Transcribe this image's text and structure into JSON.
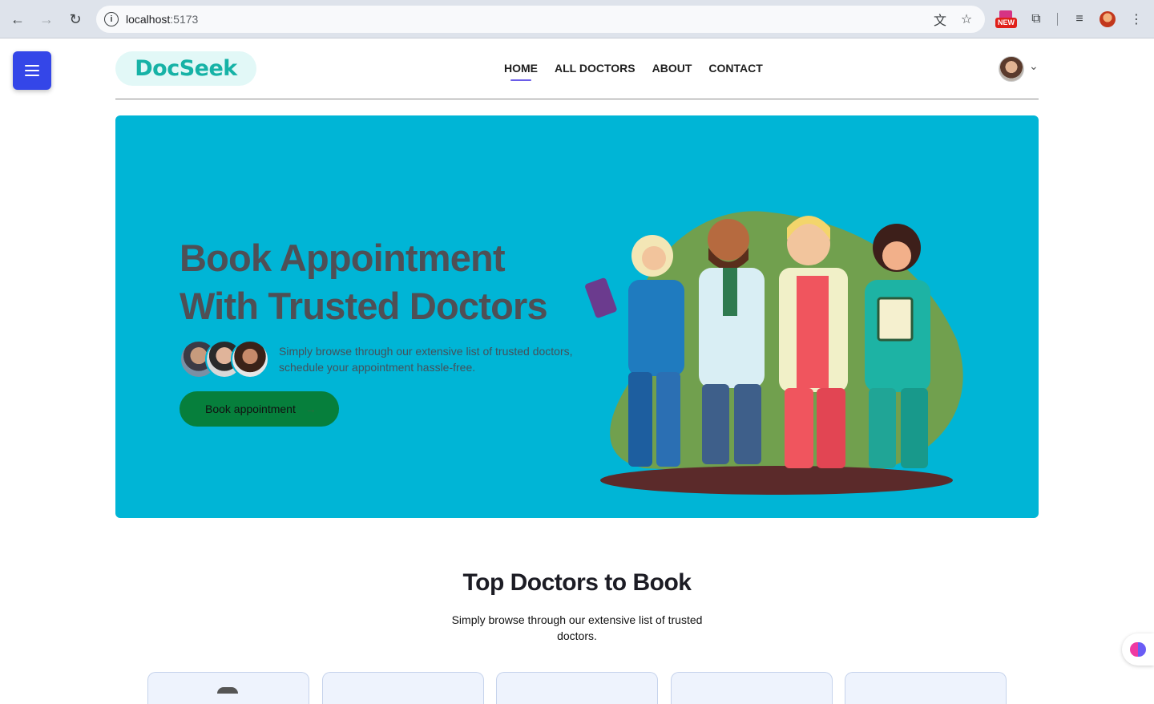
{
  "browser": {
    "url_host": "localhost",
    "url_port": ":5173",
    "new_badge": "NEW"
  },
  "site": {
    "logo": "DocSeek",
    "nav": [
      "HOME",
      "ALL DOCTORS",
      "ABOUT",
      "CONTACT"
    ],
    "active_nav": "HOME"
  },
  "hero": {
    "title_line1": "Book Appointment",
    "title_line2": "With Trusted Doctors",
    "subtitle_line1": "Simply browse through our extensive list of trusted doctors,",
    "subtitle_line2": "schedule your appointment hassle-free.",
    "cta": "Book appointment",
    "cta_arrow": "→",
    "bg_color": "#00b5d6",
    "cta_color": "#067f3c"
  },
  "top_doctors": {
    "title": "Top Doctors to Book",
    "subtitle_line1": "Simply browse through our extensive list of trusted",
    "subtitle_line2": "doctors."
  },
  "colors": {
    "accent": "#3446e8",
    "logo": "#16b2a6",
    "nav_underline": "#6a5ce8"
  },
  "icons": {
    "menu": "hamburger-menu-icon",
    "ai_assistant": "brain-icon"
  }
}
